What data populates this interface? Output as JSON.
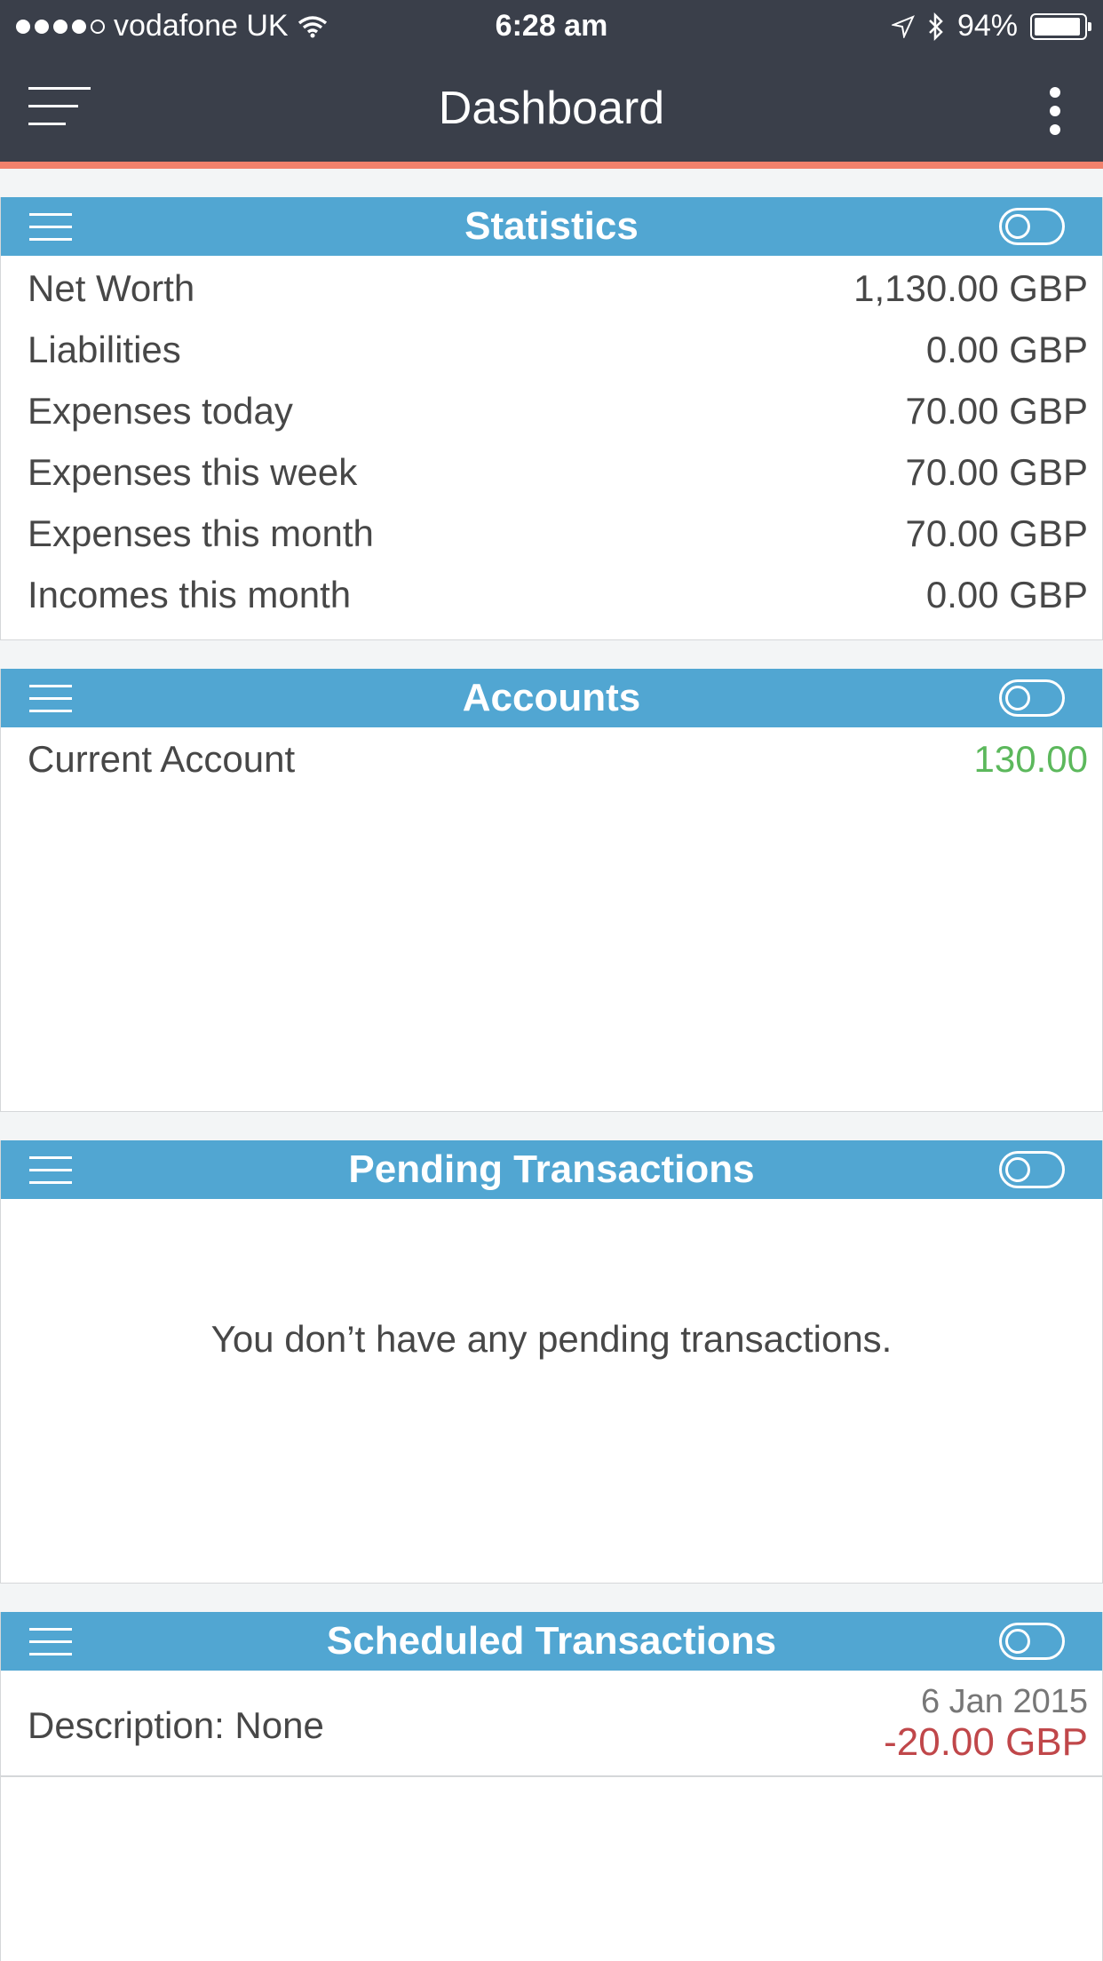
{
  "status_bar": {
    "carrier": "vodafone UK",
    "time": "6:28 am",
    "battery": "94%",
    "battery_level": 0.94
  },
  "nav": {
    "title": "Dashboard"
  },
  "statistics": {
    "title": "Statistics",
    "rows": [
      {
        "label": "Net Worth",
        "value": "1,130.00 GBP"
      },
      {
        "label": "Liabilities",
        "value": "0.00 GBP"
      },
      {
        "label": "Expenses today",
        "value": "70.00 GBP"
      },
      {
        "label": "Expenses this week",
        "value": "70.00 GBP"
      },
      {
        "label": "Expenses this month",
        "value": "70.00 GBP"
      },
      {
        "label": "Incomes this month",
        "value": "0.00 GBP"
      }
    ]
  },
  "accounts": {
    "title": "Accounts",
    "items": [
      {
        "name": "Current Account",
        "balance": "130.00",
        "color": "#5cb85c"
      }
    ]
  },
  "pending": {
    "title": "Pending Transactions",
    "empty_message": "You don’t have any pending transactions."
  },
  "scheduled": {
    "title": "Scheduled Transactions",
    "items": [
      {
        "description": "Description: None",
        "date": "6 Jan 2015",
        "amount": "-20.00 GBP",
        "color": "#c0474a"
      }
    ]
  },
  "colors": {
    "header_bar": "#3a3f4a",
    "accent_line": "#f1816c",
    "card_header": "#51a6d2"
  }
}
